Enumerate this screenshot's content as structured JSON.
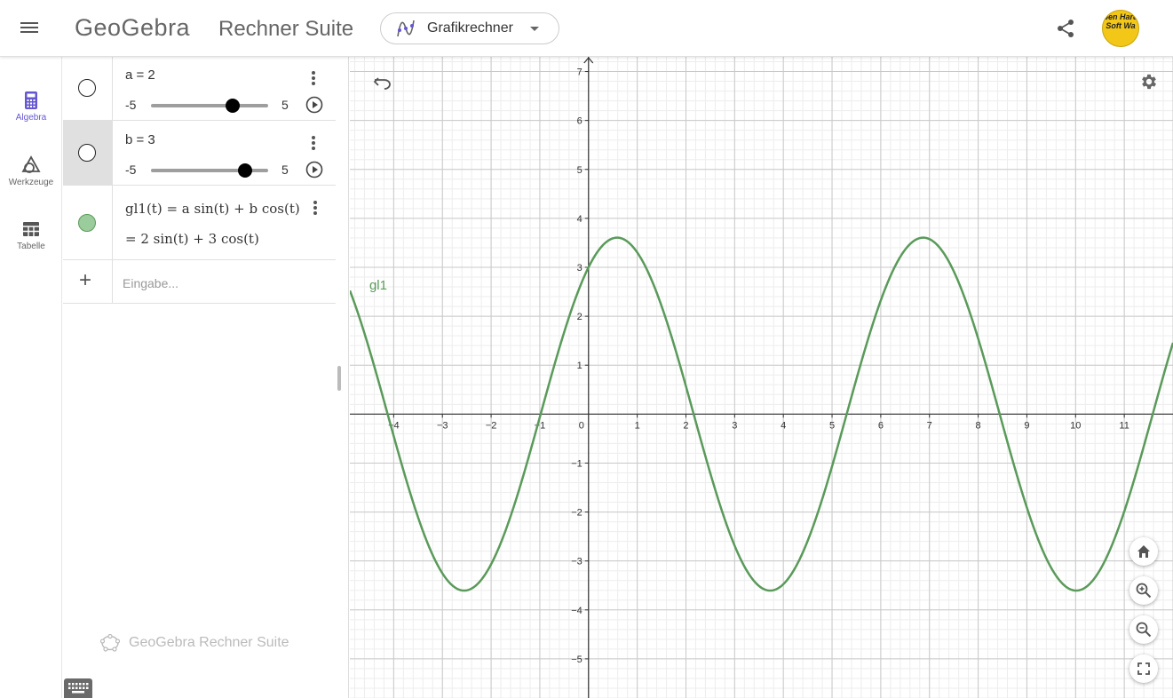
{
  "header": {
    "logo_text": "GeoGebra",
    "suite_title": "Rechner Suite",
    "app_selector_label": "Grafikrechner",
    "avatar_text": "pen Hard Soft Wa"
  },
  "rail": {
    "items": [
      {
        "label": "Algebra",
        "icon": "calculator-icon",
        "active": true
      },
      {
        "label": "Werkzeuge",
        "icon": "shapes-icon",
        "active": false
      },
      {
        "label": "Tabelle",
        "icon": "table-icon",
        "active": false
      }
    ]
  },
  "algebra": {
    "rows": [
      {
        "definition": "a = 2",
        "value": 2,
        "min_label": "-5",
        "max_label": "5",
        "min": -5,
        "max": 5
      },
      {
        "definition": "b = 3",
        "value": 3,
        "min_label": "-5",
        "max_label": "5",
        "min": -5,
        "max": 5
      },
      {
        "definition": "gl1(t) = a sin(t) + b cos(t)",
        "result": "= 2 sin(t) + 3 cos(t)"
      }
    ],
    "input_placeholder": "Eingabe...",
    "watermark": "GeoGebra Rechner Suite"
  },
  "colors": {
    "curve": "#5a9a5a",
    "accent": "#6557d2"
  },
  "chart_data": {
    "type": "line",
    "function_label": "gl1",
    "a": 2,
    "b": 3,
    "xlim": [
      -4.9,
      12.0
    ],
    "ylim": [
      -5.8,
      7.3
    ],
    "x_ticks": [
      -4,
      -3,
      -2,
      -1,
      0,
      1,
      2,
      3,
      4,
      5,
      6,
      7,
      8,
      9,
      10,
      11
    ],
    "y_ticks": [
      -5,
      -4,
      -3,
      -2,
      -1,
      1,
      2,
      3,
      4,
      5,
      6,
      7
    ],
    "x_tick_labels": [
      "−4",
      "−3",
      "−2",
      "−1",
      "0",
      "1",
      "2",
      "3",
      "4",
      "5",
      "6",
      "7",
      "8",
      "9",
      "10",
      "11"
    ],
    "y_tick_labels": [
      "−5",
      "−4",
      "−3",
      "−2",
      "−1",
      "1",
      "2",
      "3",
      "4",
      "5",
      "6",
      "7"
    ],
    "grid": true,
    "minor_grid": true
  }
}
